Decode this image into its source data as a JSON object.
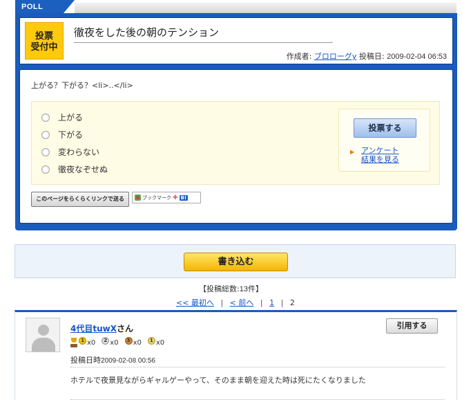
{
  "poll": {
    "tab_label": "POLL",
    "badge_line1": "投票",
    "badge_line2": "受付中",
    "title": "徹夜をした後の朝のテンション",
    "author_label": "作成者:",
    "author": "ブロローグy",
    "date_label": "投稿日:",
    "date": "2009-02-04 06:53",
    "question": "上がる？下がる？<li>..</li>",
    "options": [
      "上がる",
      "下がる",
      "変わらない",
      "徹夜なぞせぬ"
    ],
    "vote_button": "投票する",
    "results_link_line1": "アンケート",
    "results_link_line2": "結果を見る",
    "send_link_button": "このページをらくらくリンクで送る",
    "bookmark_label": "ブックマーク",
    "bookmark_hatena": "B!"
  },
  "write_button": "書き込む",
  "summary": {
    "total_prefix": "【投稿総数:",
    "total_count": "13件",
    "total_suffix": "】"
  },
  "pager": {
    "first": "<< 最初へ",
    "prev": "< 前へ",
    "page1": "1",
    "current": "2",
    "separator": "|"
  },
  "comment": {
    "username": "4代目tuwX",
    "username_suffix": "さん",
    "quote_button": "引用する",
    "medal_counts": [
      "x0",
      "x0",
      "x0",
      "x0"
    ],
    "medal_numbers": [
      "1",
      "2",
      "3",
      "1"
    ],
    "posted_label": "投稿日時",
    "posted_date": "2009-02-08 00:56",
    "text": "ホテルで夜景見ながらギャルゲーやって、そのまま朝を迎えた時は死にたくなりました"
  },
  "colors": {
    "brand_blue": "#1a5bbb",
    "badge_yellow": "#ffc90e",
    "link_blue": "#1155cc",
    "write_button_orange": "#f4b500"
  }
}
